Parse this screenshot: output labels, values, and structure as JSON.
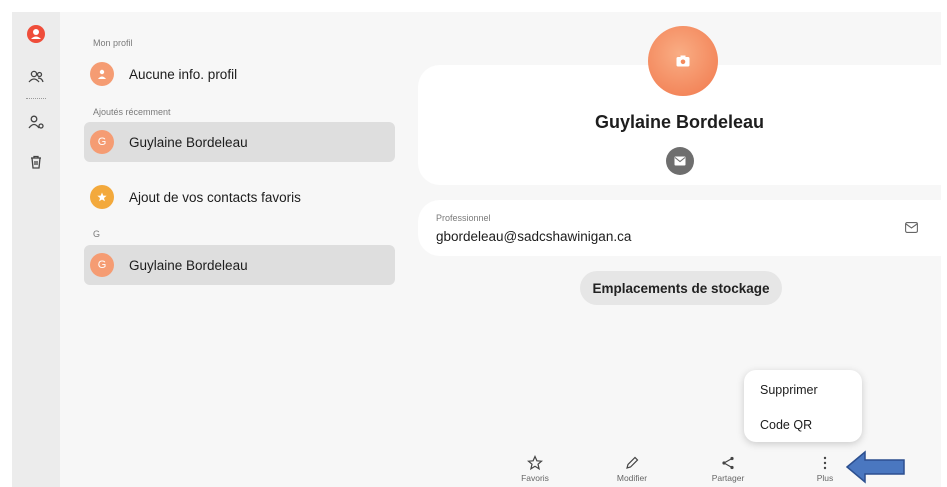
{
  "sidebar": {
    "icons": [
      "profile-icon",
      "contacts-icon",
      "manage-contacts-icon",
      "trash-icon"
    ]
  },
  "list": {
    "section_profile": "Mon profil",
    "profile_item": "Aucune info. profil",
    "section_recent": "Ajoutés récemment",
    "recent_item": "Guylaine Bordeleau",
    "recent_initial": "G",
    "favorites_item": "Ajout de vos contacts favoris",
    "section_g": "G",
    "g_item": "Guylaine Bordeleau",
    "g_initial": "G"
  },
  "contact": {
    "name": "Guylaine Bordeleau",
    "email_label": "Professionnel",
    "email": "gbordeleau@sadcshawinigan.ca",
    "storage_button": "Emplacements de stockage"
  },
  "menu": {
    "items": [
      "Supprimer",
      "Code QR"
    ]
  },
  "toolbar": {
    "favorites": "Favoris",
    "edit": "Modifier",
    "share": "Partager",
    "more": "Plus"
  },
  "colors": {
    "accent": "#f1784c",
    "profile_red": "#ef4d3a",
    "arrow_blue": "#4a77c0"
  }
}
